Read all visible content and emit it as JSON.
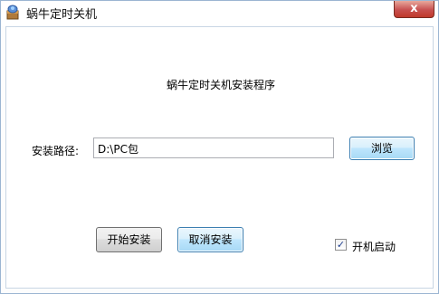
{
  "window": {
    "title": "蜗牛定时关机",
    "close_glyph": "x"
  },
  "installer": {
    "heading": "蜗牛定时关机安装程序",
    "path_label": "安装路径:",
    "path_value": "D:\\PC包",
    "browse_label": "浏览",
    "install_label": "开始安装",
    "cancel_label": "取消安装",
    "autostart_label": "开机启动",
    "autostart_checked": true,
    "check_glyph": "✓"
  },
  "colors": {
    "close_button": "#c75050",
    "focused_button": "#bee6fd",
    "window_border": "#9bb5d2"
  },
  "icons": {
    "app": "snail-installer-icon",
    "close": "close-icon",
    "check": "checkmark-icon"
  }
}
